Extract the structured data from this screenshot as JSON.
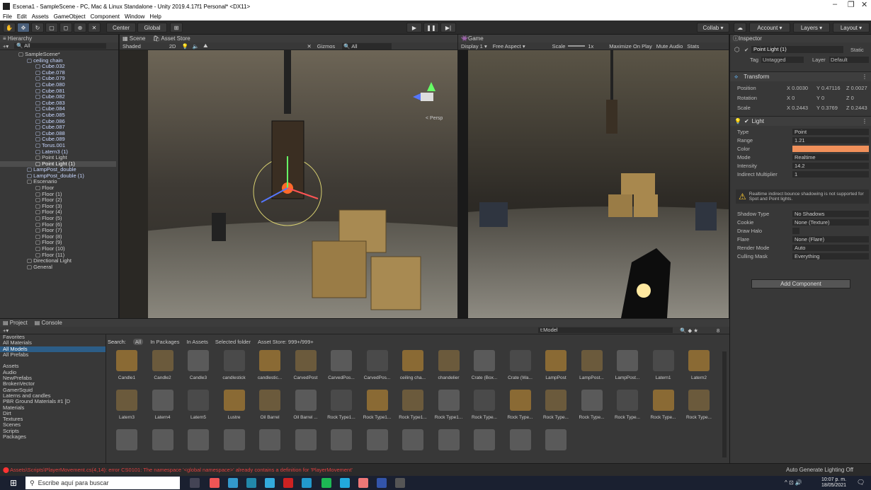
{
  "window": {
    "title": "Escena1 - SampleScene - PC, Mac & Linux Standalone - Unity 2019.4.17f1 Personal* <DX11>"
  },
  "menu": [
    "File",
    "Edit",
    "Assets",
    "GameObject",
    "Component",
    "Window",
    "Help"
  ],
  "toolbar": {
    "center": "Center",
    "global": "Global",
    "collab": "Collab",
    "account": "Account",
    "layers": "Layers",
    "layout": "Layout"
  },
  "hierarchy": {
    "tab": "Hierarchy",
    "search_placeholder": "All",
    "rows": [
      {
        "t": "SampleScene*",
        "d": 0,
        "c": "plain"
      },
      {
        "t": "ceiling chain",
        "d": 1
      },
      {
        "t": "Cube.032",
        "d": 2
      },
      {
        "t": "Cube.078",
        "d": 2
      },
      {
        "t": "Cube.079",
        "d": 2
      },
      {
        "t": "Cube.080",
        "d": 2
      },
      {
        "t": "Cube.081",
        "d": 2
      },
      {
        "t": "Cube.082",
        "d": 2
      },
      {
        "t": "Cube.083",
        "d": 2
      },
      {
        "t": "Cube.084",
        "d": 2
      },
      {
        "t": "Cube.085",
        "d": 2
      },
      {
        "t": "Cube.086",
        "d": 2
      },
      {
        "t": "Cube.087",
        "d": 2
      },
      {
        "t": "Cube.088",
        "d": 2
      },
      {
        "t": "Cube.089",
        "d": 2
      },
      {
        "t": "Torus.001",
        "d": 2
      },
      {
        "t": "Latern3 (1)",
        "d": 2
      },
      {
        "t": "Point Light",
        "d": 2,
        "c": "plain"
      },
      {
        "t": "Point Light (1)",
        "d": 2,
        "c": "sel"
      },
      {
        "t": "LampPost_double",
        "d": 1
      },
      {
        "t": "LampPost_double (1)",
        "d": 1
      },
      {
        "t": "Escenario",
        "d": 1,
        "c": "plain"
      },
      {
        "t": "Floor",
        "d": 2,
        "c": "plain"
      },
      {
        "t": "Floor (1)",
        "d": 2,
        "c": "plain"
      },
      {
        "t": "Floor (2)",
        "d": 2,
        "c": "plain"
      },
      {
        "t": "Floor (3)",
        "d": 2,
        "c": "plain"
      },
      {
        "t": "Floor (4)",
        "d": 2,
        "c": "plain"
      },
      {
        "t": "Floor (5)",
        "d": 2,
        "c": "plain"
      },
      {
        "t": "Floor (6)",
        "d": 2,
        "c": "plain"
      },
      {
        "t": "Floor (7)",
        "d": 2,
        "c": "plain"
      },
      {
        "t": "Floor (8)",
        "d": 2,
        "c": "plain"
      },
      {
        "t": "Floor (9)",
        "d": 2,
        "c": "plain"
      },
      {
        "t": "Floor (10)",
        "d": 2,
        "c": "plain"
      },
      {
        "t": "Floor (11)",
        "d": 2,
        "c": "plain"
      },
      {
        "t": "Directional Light",
        "d": 1,
        "c": "plain"
      },
      {
        "t": "General",
        "d": 1,
        "c": "plain"
      }
    ]
  },
  "scene": {
    "tab": "Scene",
    "tab2": "Asset Store",
    "shading": "Shaded",
    "mode2d": "2D",
    "gizmos": "Gizmos",
    "search": "All",
    "persp": "< Persp"
  },
  "game": {
    "tab": "Game",
    "display": "Display 1",
    "aspect": "Free Aspect",
    "scale": "Scale",
    "scale_val": "1x",
    "maximize": "Maximize On Play",
    "mute": "Mute Audio",
    "stats": "Stats"
  },
  "inspector": {
    "tab": "Inspector",
    "name": "Point Light (1)",
    "static": "Static",
    "tag_label": "Tag",
    "tag": "Untagged",
    "layer_label": "Layer",
    "layer": "Default",
    "transform": "Transform",
    "position": {
      "label": "Position",
      "x": "0.0030",
      "y": "0.47116",
      "z": "0.0027"
    },
    "rotation": {
      "label": "Rotation",
      "x": "0",
      "y": "0",
      "z": "0"
    },
    "scale": {
      "label": "Scale",
      "x": "0.2443",
      "y": "0.3769",
      "z": "0.2443"
    },
    "light": "Light",
    "props": [
      {
        "k": "Type",
        "v": "Point"
      },
      {
        "k": "Range",
        "v": "1.21"
      },
      {
        "k": "Color",
        "v": ""
      },
      {
        "k": "Mode",
        "v": "Realtime"
      },
      {
        "k": "Intensity",
        "v": "14.2"
      },
      {
        "k": "Indirect Multiplier",
        "v": "1"
      }
    ],
    "warning": "Realtime indirect bounce shadowing is not supported for Spot and Point lights.",
    "props2": [
      {
        "k": "Shadow Type",
        "v": "No Shadows"
      },
      {
        "k": "Cookie",
        "v": "None (Texture)"
      },
      {
        "k": "Draw Halo",
        "v": ""
      },
      {
        "k": "Flare",
        "v": "None (Flare)"
      },
      {
        "k": "Render Mode",
        "v": "Auto"
      },
      {
        "k": "Culling Mask",
        "v": "Everything"
      }
    ],
    "add_component": "Add Component",
    "light_color": "#f0905a"
  },
  "project": {
    "tab": "Project",
    "tab2": "Console",
    "search_value": "t:Model",
    "search_label": "Search:",
    "scopes": [
      "All",
      "In Packages",
      "In Assets",
      "Selected folder",
      "Asset Store: 999+/999+"
    ],
    "count": "8",
    "tree": [
      {
        "t": "Favorites",
        "c": "plain"
      },
      {
        "t": "All Materials"
      },
      {
        "t": "All Models",
        "c": "sel"
      },
      {
        "t": "All Prefabs"
      },
      {
        "t": ""
      },
      {
        "t": "Assets",
        "c": "plain"
      },
      {
        "t": "Audio"
      },
      {
        "t": "NewPrefabs"
      },
      {
        "t": "BrokenVector"
      },
      {
        "t": "GamerSquid"
      },
      {
        "t": "Laterns and candles"
      },
      {
        "t": "PBR Ground Materials #1 [D"
      },
      {
        "t": "Materials"
      },
      {
        "t": "Dirt"
      },
      {
        "t": "Textures"
      },
      {
        "t": "Scenes"
      },
      {
        "t": "Scripts"
      },
      {
        "t": "Packages",
        "c": "plain"
      }
    ],
    "assets_row1": [
      "Candle1",
      "Candle2",
      "Candle3",
      "candlestick",
      "candlestic...",
      "CarvedPost",
      "CarvedPos...",
      "CarvedPos...",
      "ceiling cha...",
      "chandelier",
      "Crate (Box...",
      "Crate (Wa...",
      "LampPost",
      "LampPost...",
      "LampPost...",
      "Latern1",
      "Latern2"
    ],
    "assets_row2": [
      "Latern3",
      "Latern4",
      "Latern5",
      "Lustre",
      "Oil Barrel",
      "Oil Barrel ...",
      "Rock Type1...",
      "Rock Type1...",
      "Rock Type1...",
      "Rock Type1...",
      "Rock Type...",
      "Rock Type...",
      "Rock Type...",
      "Rock Type...",
      "Rock Type...",
      "Rock Type...",
      "Rock Type..."
    ]
  },
  "status": {
    "error": "Assets\\Scripts\\PlayerMovement.cs(4,14): error CS0101: The namespace '<global namespace>' already contains a definition for 'PlayerMovement'",
    "lighting": "Auto Generate Lighting Off"
  },
  "taskbar": {
    "search": "Escribe aquí para buscar",
    "time": "10:07 p. m.",
    "date": "18/05/2021"
  }
}
